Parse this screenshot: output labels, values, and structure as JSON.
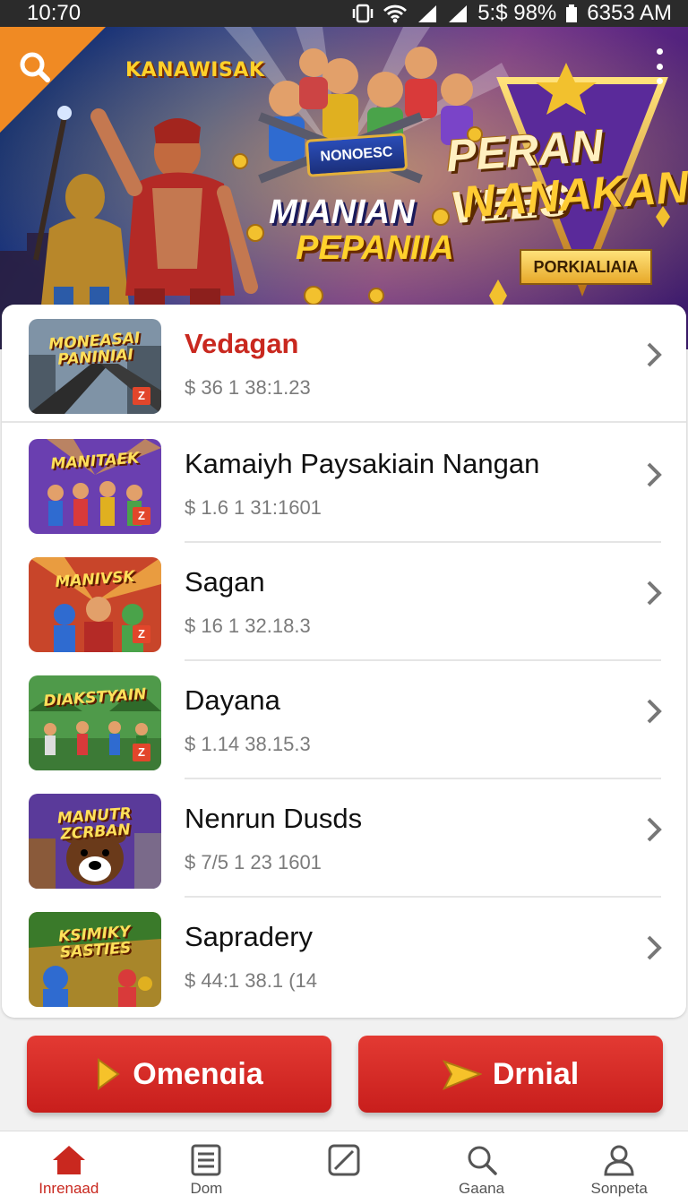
{
  "status_bar": {
    "time": "10:70",
    "battery_text": "5:$ 98%",
    "clock_right": "6353 AM"
  },
  "banner": {
    "logo_left": "KANAWISAK",
    "logo_mid": "NONOESC",
    "title_line1": "MIANIAN",
    "title_line2": "PEPANIIA",
    "badge_line1": "PERAN VEES",
    "badge_line2": "NANAKAN",
    "badge_ribbon": "PORKIALIAIA"
  },
  "list": {
    "items": [
      {
        "title": "Vedagan",
        "price": "$ 36 1 38:1.23",
        "thumb_label": "MONEASAI PANINIAI",
        "thumb_badge": "Z"
      },
      {
        "title": "Kamaiyh Paysakiain Nangan",
        "price": "$ 1.6 1 31:1601",
        "thumb_label": "MANITAEK",
        "thumb_badge": "Z"
      },
      {
        "title": "Sagan",
        "price": "$ 16 1 32.18.3",
        "thumb_label": "MANIVSK",
        "thumb_badge": "Z"
      },
      {
        "title": "Dayana",
        "price": "$ 1.14 38.15.3",
        "thumb_label": "DIAKSTYAIN",
        "thumb_badge": "Z"
      },
      {
        "title": "Nenrun Dusds",
        "price": "$ 7/5 1 23 1601",
        "thumb_label": "MANUTR ZCRBAN",
        "thumb_badge": ""
      },
      {
        "title": "Sapradery",
        "price": "$ 44:1 38.1 (14",
        "thumb_label": "KSIMIKY SASTIES",
        "thumb_badge": ""
      }
    ]
  },
  "actions": {
    "left_label": "Omenɑia",
    "right_label": "Drnial"
  },
  "bottom_nav": {
    "items": [
      {
        "label": "Inrenaad",
        "icon": "home-icon"
      },
      {
        "label": "Dom",
        "icon": "document-icon"
      },
      {
        "label": "",
        "icon": "edit-square-icon"
      },
      {
        "label": "Gaana",
        "icon": "search-icon"
      },
      {
        "label": "Sonpeta",
        "icon": "person-icon"
      }
    ]
  },
  "colors": {
    "accent_red": "#c9281f",
    "button_red": "#e33a33",
    "search_corner_orange": "#f08a23"
  }
}
